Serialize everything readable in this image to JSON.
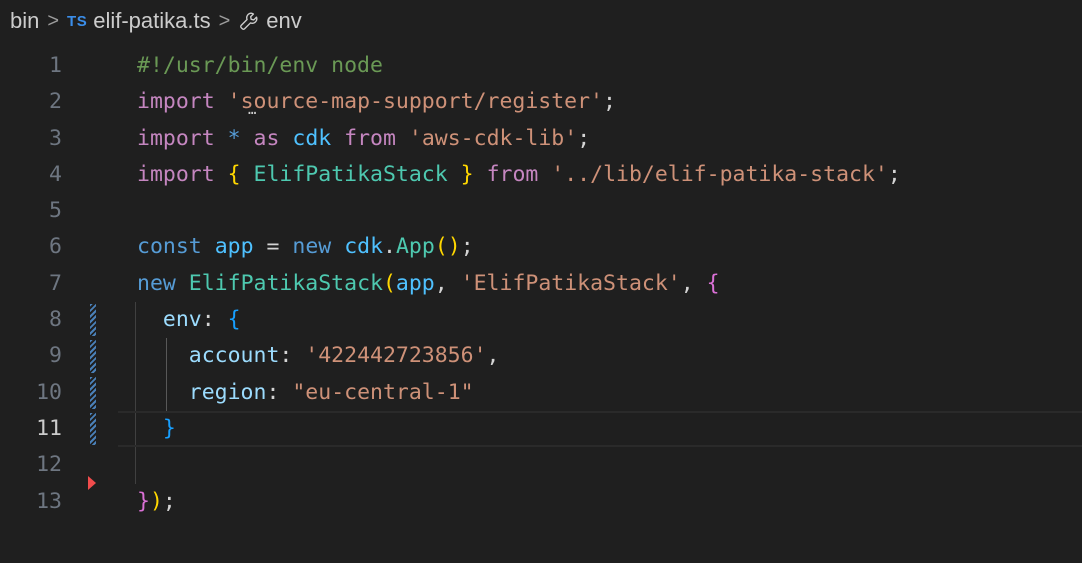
{
  "breadcrumb": {
    "folder": "bin",
    "separator": ">",
    "file_badge": "TS",
    "file": "elif-patika.ts",
    "symbol_icon": "wrench-icon",
    "symbol": "env"
  },
  "editor": {
    "current_line": 11,
    "lines": [
      {
        "n": "1",
        "tokens": [
          [
            "#!/usr/bin/env node",
            "comment"
          ]
        ]
      },
      {
        "n": "2",
        "tokens": [
          [
            "import",
            "ctrl"
          ],
          [
            " ",
            "txt"
          ],
          [
            "'source-map-support/register'",
            "str"
          ],
          [
            ";",
            "op"
          ]
        ]
      },
      {
        "n": "3",
        "tokens": [
          [
            "import",
            "ctrl"
          ],
          [
            " ",
            "txt"
          ],
          [
            "*",
            "const"
          ],
          [
            " ",
            "txt"
          ],
          [
            "as",
            "ctrl"
          ],
          [
            " ",
            "txt"
          ],
          [
            "cdk",
            "var"
          ],
          [
            " ",
            "txt"
          ],
          [
            "from",
            "ctrl"
          ],
          [
            " ",
            "txt"
          ],
          [
            "'aws-cdk-lib'",
            "str"
          ],
          [
            ";",
            "op"
          ]
        ]
      },
      {
        "n": "4",
        "tokens": [
          [
            "import",
            "ctrl"
          ],
          [
            " ",
            "txt"
          ],
          [
            "{",
            "b1"
          ],
          [
            " ",
            "txt"
          ],
          [
            "ElifPatikaStack",
            "cls"
          ],
          [
            " ",
            "txt"
          ],
          [
            "}",
            "b1"
          ],
          [
            " ",
            "txt"
          ],
          [
            "from",
            "ctrl"
          ],
          [
            " ",
            "txt"
          ],
          [
            "'../lib/elif-patika-stack'",
            "str"
          ],
          [
            ";",
            "op"
          ]
        ]
      },
      {
        "n": "5",
        "tokens": []
      },
      {
        "n": "6",
        "tokens": [
          [
            "const",
            "const"
          ],
          [
            " ",
            "txt"
          ],
          [
            "app",
            "var"
          ],
          [
            " ",
            "txt"
          ],
          [
            "=",
            "op"
          ],
          [
            " ",
            "txt"
          ],
          [
            "new",
            "const"
          ],
          [
            " ",
            "txt"
          ],
          [
            "cdk",
            "var"
          ],
          [
            ".",
            "op"
          ],
          [
            "App",
            "cls"
          ],
          [
            "()",
            "b1"
          ],
          [
            ";",
            "op"
          ]
        ]
      },
      {
        "n": "7",
        "tokens": [
          [
            "new",
            "const"
          ],
          [
            " ",
            "txt"
          ],
          [
            "ElifPatikaStack",
            "cls"
          ],
          [
            "(",
            "b1"
          ],
          [
            "app",
            "var"
          ],
          [
            ",",
            "op"
          ],
          [
            " ",
            "txt"
          ],
          [
            "'ElifPatikaStack'",
            "str"
          ],
          [
            ",",
            "op"
          ],
          [
            " ",
            "txt"
          ],
          [
            "{",
            "b2"
          ]
        ]
      },
      {
        "n": "8",
        "tokens": [
          [
            "  ",
            "txt"
          ],
          [
            "env",
            "prop"
          ],
          [
            ":",
            "op"
          ],
          [
            " ",
            "txt"
          ],
          [
            "{",
            "b3"
          ]
        ]
      },
      {
        "n": "9",
        "tokens": [
          [
            "    ",
            "txt"
          ],
          [
            "account",
            "prop"
          ],
          [
            ":",
            "op"
          ],
          [
            " ",
            "txt"
          ],
          [
            "'422442723856'",
            "str"
          ],
          [
            ",",
            "op"
          ]
        ]
      },
      {
        "n": "10",
        "tokens": [
          [
            "    ",
            "txt"
          ],
          [
            "region",
            "prop"
          ],
          [
            ":",
            "op"
          ],
          [
            " ",
            "txt"
          ],
          [
            "\"eu-central-1\"",
            "str"
          ]
        ]
      },
      {
        "n": "11",
        "tokens": [
          [
            "  ",
            "txt"
          ],
          [
            "}",
            "b3"
          ]
        ]
      },
      {
        "n": "12",
        "tokens": []
      },
      {
        "n": "13",
        "tokens": [
          [
            "}",
            "b2"
          ],
          [
            ")",
            "b1"
          ],
          [
            ";",
            "op"
          ]
        ]
      }
    ]
  }
}
